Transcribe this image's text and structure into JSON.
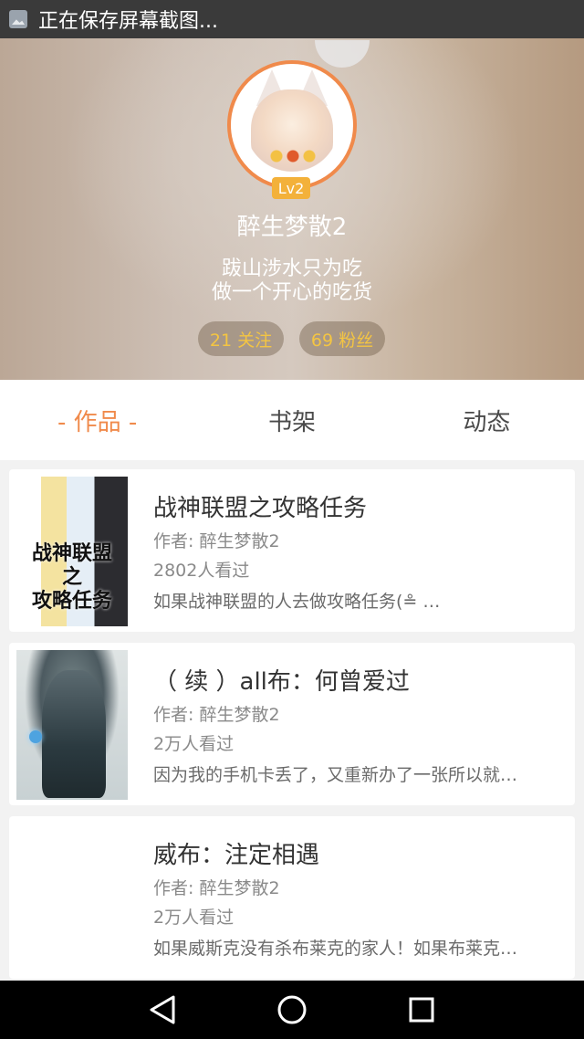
{
  "status_bar": {
    "notification_text": "正在保存屏幕截图..."
  },
  "profile": {
    "level": "Lv2",
    "username": "醉生梦散2",
    "bio_line1": "跋山涉水只为吃",
    "bio_line2": "做一个开心的吃货",
    "following": "21 关注",
    "fans": "69 粉丝"
  },
  "tabs": [
    {
      "label": "- 作品 -",
      "active": true
    },
    {
      "label": "书架",
      "active": false
    },
    {
      "label": "动态",
      "active": false
    }
  ],
  "works": [
    {
      "title": "战神联盟之攻略任务",
      "author": "作者: 醉生梦散2",
      "views": "2802人看过",
      "description": "如果战神联盟的人去做攻略任务(≗ …",
      "cover_text": "战神联盟\n之\n攻略任务"
    },
    {
      "title": "（ 续 ）all布：何曾爱过",
      "author": "作者: 醉生梦散2",
      "views": "2万人看过",
      "description": "因为我的手机卡丢了，又重新办了一张所以就…"
    },
    {
      "title": "威布：注定相遇",
      "author": "作者: 醉生梦散2",
      "views": "2万人看过",
      "description": "如果威斯克没有杀布莱克的家人！如果布莱克…"
    }
  ],
  "colors": {
    "accent": "#f08a4b",
    "badge": "#f3b13a",
    "stat_text": "#f4c542"
  }
}
